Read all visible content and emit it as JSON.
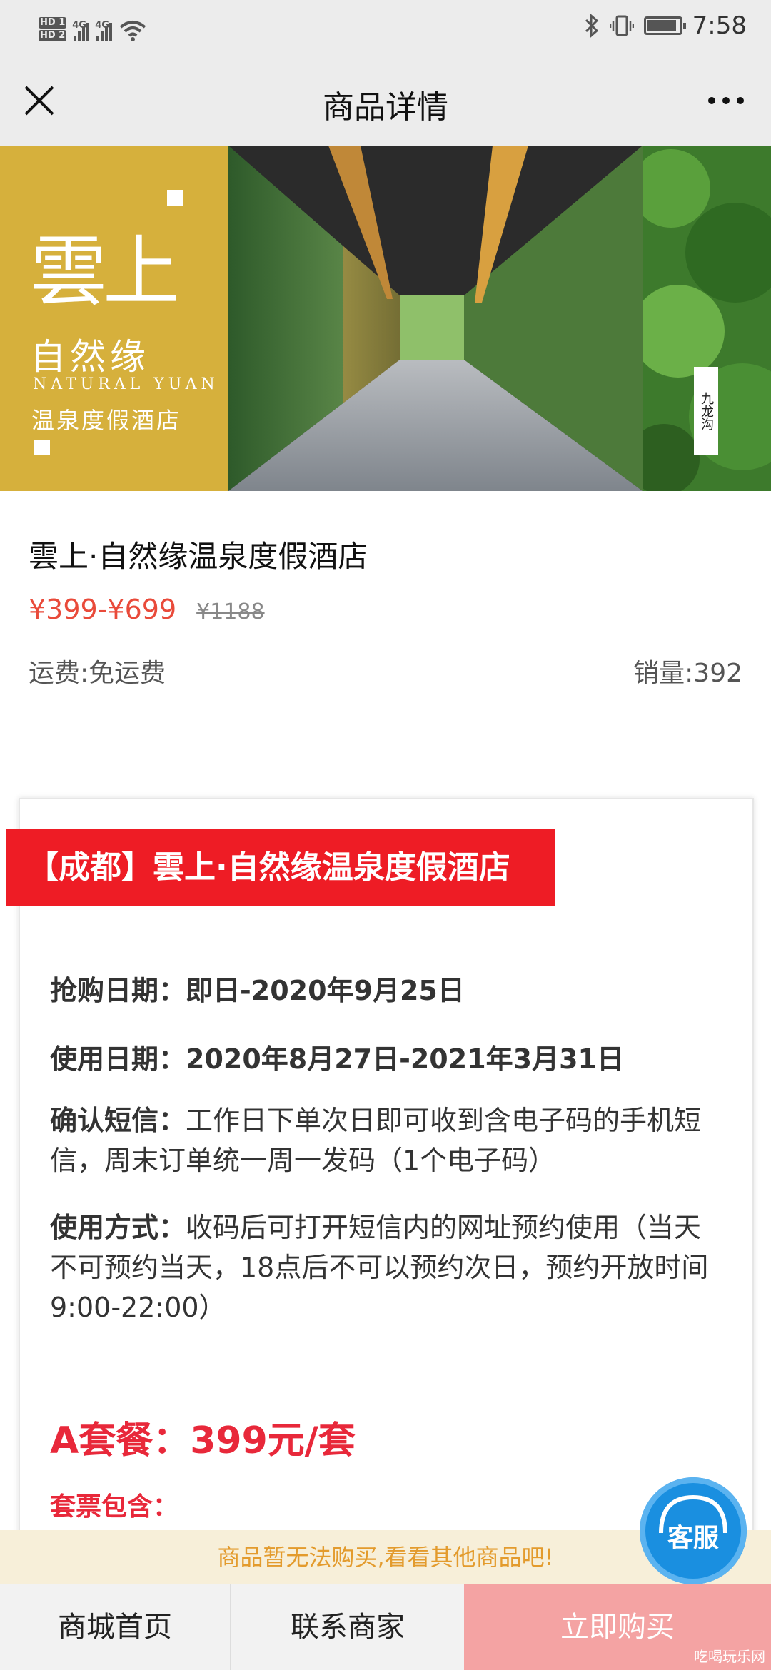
{
  "status_bar": {
    "time": "7:58",
    "network_1": "4G",
    "network_2": "4G",
    "sim1": "HD 1",
    "sim2": "HD 2"
  },
  "nav": {
    "title": "商品详情"
  },
  "banner": {
    "big_text": "雲上",
    "sub_text": "自然缘",
    "english": "NATURAL YUAN",
    "cn_text": "温泉度假酒店",
    "vertical": "九龙沟"
  },
  "product": {
    "name": "雲上·自然缘温泉度假酒店",
    "price": "¥399-¥699",
    "original_price": "¥1188",
    "shipping": "运费:免运费",
    "sales": "销量:392"
  },
  "detail": {
    "red_title": "【成都】雲上·自然缘温泉度假酒店",
    "rush_label": "抢购日期：",
    "rush_value": "即日-2020年9月25日",
    "use_label": "使用日期：",
    "use_value": "2020年8月27日-2021年3月31日",
    "sms_label": "确认短信：",
    "sms_value": "工作日下单次日即可收到含电子码的手机短信，周末订单统一周一发码（1个电子码）",
    "method_label": "使用方式：",
    "method_value": "收码后可打开短信内的网址预约使用（当天不可预约当天，18点后不可以预约次日，预约开放时间9:00-22:00）",
    "package_a": "A套餐：399元/套",
    "includes": "套票包含："
  },
  "customer_service": {
    "label": "客服"
  },
  "notice": "商品暂无法购买,看看其他商品吧!",
  "bottom_bar": {
    "home": "商城首页",
    "contact": "联系商家",
    "buy": "立即购买"
  },
  "watermark": "吃喝玩乐网",
  "colors": {
    "price_red": "#e94a3a",
    "banner_red": "#ee1c25",
    "buy_button": "#f4a3a3",
    "notice_text": "#e39b2d",
    "banner_gold": "#d6b03c"
  }
}
